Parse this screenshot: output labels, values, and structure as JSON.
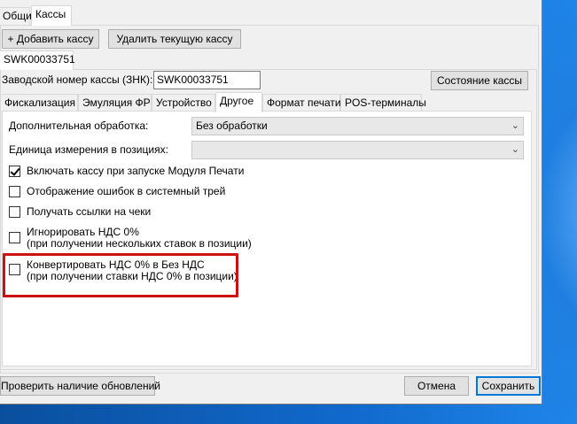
{
  "top_tabs": [
    "Общие",
    "Кассы"
  ],
  "buttons": {
    "add_register": "+ Добавить кассу",
    "remove_register": "Удалить текущую кассу",
    "register_status": "Состояние кассы",
    "check_updates": "Проверить наличие обновлений",
    "cancel": "Отмена",
    "save": "Сохранить"
  },
  "register_tab": "SWK00033751",
  "serial": {
    "label": "Заводской номер кассы (ЗНК):",
    "value": "SWK00033751"
  },
  "inner_tabs": [
    "Фискализация",
    "Эмуляция ФР",
    "Устройство",
    "Другое",
    "Формат печати",
    "POS-терминалы"
  ],
  "active_inner_tab": "Другое",
  "fields": {
    "extra_processing": {
      "label": "Дополнительная обработка:",
      "value": "Без обработки"
    },
    "unit": {
      "label": "Единица измерения в позициях:",
      "value": ""
    }
  },
  "checkboxes": [
    {
      "line1": "Включать кассу при запуске Модуля Печати",
      "line2": "",
      "checked": true
    },
    {
      "line1": "Отображение ошибок в системный трей",
      "line2": "",
      "checked": false
    },
    {
      "line1": "Получать ссылки на чеки",
      "line2": "",
      "checked": false
    },
    {
      "line1": "Игнорировать НДС 0%",
      "line2": "(при получении нескольких ставок в позиции)",
      "checked": false
    },
    {
      "line1": "Конвертировать НДС 0% в Без НДС",
      "line2": "(при получении ставки НДС 0% в позиции)",
      "checked": false
    }
  ],
  "colors": {
    "highlight": "#cc1111",
    "accent": "#0078d7"
  }
}
